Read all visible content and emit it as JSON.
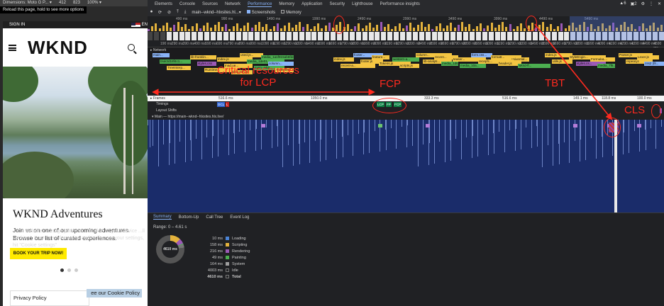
{
  "device_toolbar": {
    "dimensions": "Dimensions: Moto G P... ▾",
    "width": "412",
    "height": "823",
    "zoom": "100% ▾",
    "tooltip": "Reload this page, hold to see more options"
  },
  "site": {
    "signin": "SIGN IN",
    "flag_text": "EN",
    "logo": "WKND",
    "headline": "WKND Adventures",
    "subtext": "Join us on one of our upcoming adventures. Browse our list of curated experiences.",
    "cookie_ghost": "...our website. ...usage patterns. ...cookie on your device ...ll cookies\". For more information and to change your settings, hit \"Cookie settings\"",
    "cta": "BOOK YOUR TRIP NOW!",
    "privacy": "Privacy Policy",
    "cookie_policy": "ee our Cookie Policy"
  },
  "devtools": {
    "tabs": [
      "Elements",
      "Console",
      "Sources",
      "Network",
      "Performance",
      "Memory",
      "Application",
      "Security",
      "Lighthouse",
      "Performance insights"
    ],
    "active_tab": "Performance",
    "right_status": [
      "▲6",
      "▣2",
      "⚙",
      "⋮",
      "✕"
    ],
    "perf_bar": {
      "url": "main--wknd--hlxsites.hl...▾",
      "screenshots": "Screenshots",
      "memory": "Memory"
    },
    "overview_ticks": [
      "490 ms",
      "990 ms",
      "1490 ms",
      "1990 ms",
      "2490 ms",
      "2990 ms",
      "3490 ms",
      "3990 ms",
      "4490 ms",
      "5490 ms"
    ],
    "ruler_ticks": [
      "190 ms",
      "290 ms",
      "390 ms",
      "490 ms",
      "590 ms",
      "690 ms",
      "790 ms",
      "890 ms",
      "990 ms",
      "1090 ms",
      "1190 ms",
      "1290 ms",
      "1390 ms",
      "1490 ms",
      "1590 ms",
      "1690 ms",
      "1790 ms",
      "1890 ms",
      "1990 ms",
      "2090 ms",
      "2190 ms",
      "2290 ms",
      "2390 ms",
      "2490 ms",
      "2590 ms",
      "2690 ms",
      "2790 ms",
      "2890 ms",
      "2990 ms",
      "3090 ms",
      "3190 ms",
      "3290 ms",
      "3390 ms",
      "3490 ms",
      "3590 ms",
      "3690 ms",
      "3790 ms",
      "3890 ms",
      "3990 ms",
      "4090 ms",
      "4190 ms",
      "4290 ms",
      "4390 ms",
      "4490 ms",
      "4590 ms"
    ],
    "network_label": "▸ Network",
    "requests": [
      {
        "t": "main...",
        "c": "#8ab4f8"
      },
      {
        "t": "lib-franklin...",
        "c": "#f4c542"
      },
      {
        "t": "index.js",
        "c": "#f4c542"
      },
      {
        "t": "used.js...",
        "c": "#f4c542"
      },
      {
        "t": "media_1a1f915ab6fdcccd7...",
        "c": "#4caf50"
      },
      {
        "t": "index.js",
        "c": "#f4c542"
      },
      {
        "t": "footer...",
        "c": "#8ab4f8"
      },
      {
        "t": "feature...",
        "c": "#f4c542"
      },
      {
        "t": "western-a...",
        "c": "#4caf50"
      },
      {
        "t": "column...",
        "c": "#f4c542"
      },
      {
        "t": "recent...",
        "c": "#f4c542"
      },
      {
        "t": "teaser...",
        "c": "#f4c542"
      },
      {
        "t": "form.css...",
        "c": "#8ab4f8"
      },
      {
        "t": "formatt...",
        "c": "#f4c542"
      },
      {
        "t": "universal...",
        "c": "#f4c542"
      },
      {
        "t": "index.js",
        "c": "#f4c542"
      },
      {
        "t": "StyleEngin...",
        "c": "#f4c542"
      },
      {
        "t": "FormulaL...",
        "c": "#f4c542"
      },
      {
        "t": "Parser.js",
        "c": "#f4c542"
      },
      {
        "t": "Lexer.js",
        "c": "#f4c542"
      },
      {
        "t": "bluk3d18f4c1...",
        "c": "#4caf50"
      },
      {
        "t": "styles.css",
        "c": "#9b59b6"
      },
      {
        "t": "Inad.ue...",
        "c": "#f4c542"
      },
      {
        "t": "media_1de01...",
        "c": "#4caf50"
      },
      {
        "t": "column...",
        "c": "#8ab4f8"
      },
      {
        "t": "recent-a...",
        "c": "#f4c542"
      },
      {
        "t": "footer.js",
        "c": "#f4c542"
      },
      {
        "t": "Tokens.js",
        "c": "#f4c542"
      },
      {
        "t": "scripts.js",
        "c": "#f4c542"
      },
      {
        "t": "lib-analyti...",
        "c": "#f4c542"
      },
      {
        "t": "media_1d6c4a...",
        "c": "#4caf50"
      },
      {
        "t": "media_10a...",
        "c": "#4caf50"
      },
      {
        "t": "recepfc...",
        "c": "#f4c542"
      },
      {
        "t": "header.js",
        "c": "#f4c542"
      },
      {
        "t": "wknd-fl...",
        "c": "#4caf50"
      },
      {
        "t": "utils.js",
        "c": "#f4c542"
      },
      {
        "t": "styles.cs...",
        "c": "#9b59b6"
      },
      {
        "t": "media_7f6...",
        "c": "#4caf50"
      },
      {
        "t": "repeat.js",
        "c": "#f4c542"
      },
      {
        "t": "css2 (fil...",
        "c": "#8ab4f8"
      },
      {
        "t": "TreeInterp...",
        "c": "#f4c542"
      },
      {
        "t": "Runtime...",
        "c": "#f4c542"
      },
      {
        "t": "alloy.min.js",
        "c": "#f4c542"
      },
      {
        "t": "main--wkn...",
        "c": "#4caf50"
      },
      {
        "t": "TreeInterp...",
        "c": "#f4c542"
      }
    ],
    "frames_label": "▸ Frames",
    "frames": [
      "516.6 ms",
      "1050.0 ms",
      "333.3 ms",
      "516.6 ms",
      "149.1 ms",
      "118.8 ms",
      "100.0 ms"
    ],
    "timings_label": "Timings",
    "timings_badges": [
      {
        "t": "DCL",
        "c": "#3367d6"
      },
      {
        "t": "L",
        "c": "#c5221f"
      },
      {
        "t": "LCP",
        "c": "#0b8043"
      },
      {
        "t": "FP",
        "c": "#0b8043"
      },
      {
        "t": "FCP",
        "c": "#0b8043"
      }
    ],
    "layout_shifts_label": "Layout Shifts",
    "main_label": "▾ Main — https://main--wknd--hlxsites.hlx.live/",
    "bottom_tabs": [
      "Summary",
      "Bottom-Up",
      "Call Tree",
      "Event Log"
    ],
    "active_bottom_tab": "Summary",
    "range": "Range: 0 – 4.61 s",
    "donut_total": "4610 ms",
    "summary": [
      {
        "ms": "10 ms",
        "label": "Loading",
        "color": "#4b84d6"
      },
      {
        "ms": "158 ms",
        "label": "Scripting",
        "color": "#e3b23c"
      },
      {
        "ms": "216 ms",
        "label": "Rendering",
        "color": "#9b59b6"
      },
      {
        "ms": "49 ms",
        "label": "Painting",
        "color": "#4caf50"
      },
      {
        "ms": "164 ms",
        "label": "System",
        "color": "#9e9e9e"
      },
      {
        "ms": "4003 ms",
        "label": "Idle",
        "color": "#202124"
      },
      {
        "ms": "4610 ms",
        "label": "Total",
        "color": "#202124"
      }
    ]
  },
  "annotations": {
    "critical": "Critical resources\nfor LCP",
    "fcp": "FCP",
    "tbt": "TBT",
    "cls": "CLS",
    "color": "#ff2a1f"
  }
}
